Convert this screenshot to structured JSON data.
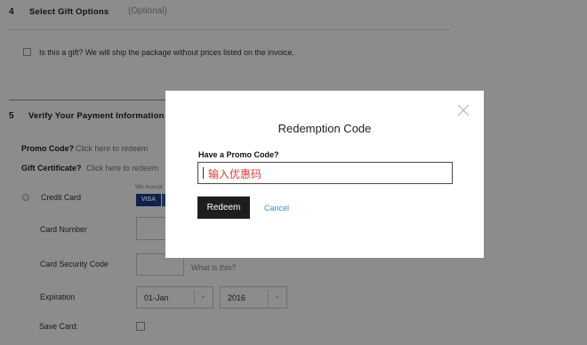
{
  "step4": {
    "number": "4",
    "title": "Select Gift Options",
    "optional": "(Optional)",
    "gift_checkbox_label": "Is this a gift? We will ship the package without prices listed on the invoice."
  },
  "step5": {
    "number": "5",
    "title": "Verify Your Payment Information",
    "promo_label": "Promo Code?",
    "promo_link": "Click here to redeem",
    "gift_cert_label": "Gift Certificate?",
    "gift_cert_link": "Click here to redeem",
    "credit_card_label": "Credit Card",
    "we_accept": "We Accept",
    "card_logos": [
      "VISA"
    ],
    "card_number_label": "Card Number",
    "security_code_label": "Card Security Code",
    "what_is_this": "What is this?",
    "expiration_label": "Expiration",
    "expiration_month": "01-Jan",
    "expiration_year": "2016",
    "save_card_label": "Save Card:"
  },
  "modal": {
    "title": "Redemption Code",
    "promo_label": "Have a Promo Code?",
    "promo_input_value": "输入优惠码",
    "redeem_button": "Redeem",
    "cancel_link": "Cancel"
  },
  "colors": {
    "overlay": "#000000",
    "primary_button": "#1e1e1e",
    "link_blue": "#3d8fc9",
    "input_text": "#e03c3c"
  },
  "icons": [
    "close-icon",
    "chevron-down-icon"
  ]
}
